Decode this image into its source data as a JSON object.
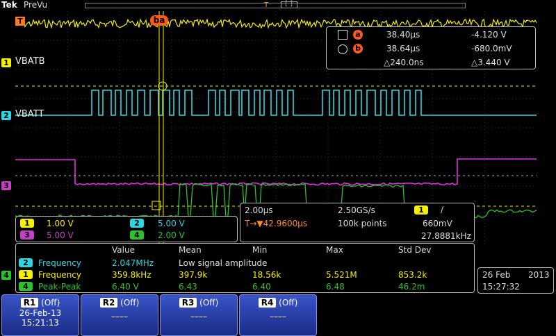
{
  "header": {
    "brand": "Tek",
    "mode": "PreVu",
    "trigger_pos_marker": "T",
    "bracket_marker": "[ ]"
  },
  "channels": [
    {
      "num": "1",
      "label": "VBATB",
      "color": "#f4f000"
    },
    {
      "num": "2",
      "label": "VBATT",
      "color": "#2ad7e3"
    },
    {
      "num": "3",
      "label": "",
      "color": "#e62ce6"
    },
    {
      "num": "4",
      "label": "",
      "color": "#2ac42a"
    }
  ],
  "trigger_marker": "T",
  "cursor_tag": "ba",
  "cursor_readout": {
    "a": {
      "tag": "a",
      "time": "38.40µs",
      "volt": "-4.120 V"
    },
    "b": {
      "tag": "b",
      "time": "38.64µs",
      "volt": "-680.0mV"
    },
    "delta": {
      "time": "△240.0ns",
      "volt": "△3.440 V"
    }
  },
  "vertical_scales": [
    {
      "ch": "1",
      "value": "1.00 V",
      "color": "#f4f000"
    },
    {
      "ch": "2",
      "value": "5.00 V",
      "color": "#2ad7e3"
    },
    {
      "ch": "3",
      "value": "5.00 V",
      "color": "#c73fc7"
    },
    {
      "ch": "4",
      "value": "2.00 V",
      "color": "#2ac42a"
    }
  ],
  "horizontal": {
    "timebase": "2.00µs",
    "sample_rate": "2.50GS/s",
    "trigger_ch": "1",
    "slope": "/",
    "position": "T→▼42.9600µs",
    "record": "100k points",
    "level": "660mV",
    "freq": "27.8881kHz"
  },
  "measurements": {
    "headers": [
      "Value",
      "Mean",
      "Min",
      "Max",
      "Std Dev"
    ],
    "rows": [
      {
        "ch": "2",
        "name": "Frequency",
        "color": "#2ad7e3",
        "value": "2.047MHz",
        "mean": "Low signal amplitude",
        "min": "",
        "max": "",
        "std": ""
      },
      {
        "ch": "1",
        "name": "Frequency",
        "color": "#f4f000",
        "value": "359.8kHz",
        "mean": "397.9k",
        "min": "18.56k",
        "max": "5.521M",
        "std": "853.2k"
      },
      {
        "ch": "4",
        "name": "Peak-Peak",
        "color": "#2ac42a",
        "value": "6.40 V",
        "mean": "6.43",
        "min": "6.40",
        "max": "6.48",
        "std": "46.2m"
      }
    ],
    "side_marker": "4"
  },
  "clock": {
    "date": "26 Feb",
    "year": "2013",
    "time": "15:27:32"
  },
  "ref_buttons": [
    {
      "name": "R1",
      "state": "(Off)",
      "line1": "26-Feb-13",
      "line2": "15:21:13"
    },
    {
      "name": "R2",
      "state": "(Off)",
      "line1": "––––",
      "line2": ""
    },
    {
      "name": "R3",
      "state": "(Off)",
      "line1": "––––",
      "line2": ""
    },
    {
      "name": "R4",
      "state": "(Off)",
      "line1": "––––",
      "line2": ""
    }
  ]
}
